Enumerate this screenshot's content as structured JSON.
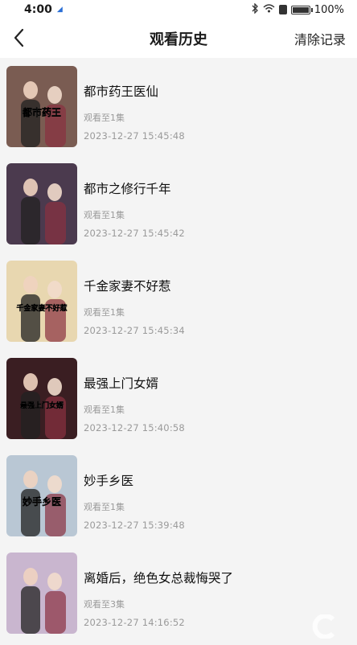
{
  "status_bar": {
    "time": "4:00",
    "battery": "100%"
  },
  "nav": {
    "title": "观看历史",
    "clear_label": "清除记录"
  },
  "items": [
    {
      "title": "都市药王医仙",
      "progress": "观看至1集",
      "time": "2023-12-27 15:45:48",
      "poster_text": "都市药王",
      "poster_color": "#7a5c52"
    },
    {
      "title": "都市之修行千年",
      "progress": "观看至1集",
      "time": "2023-12-27 15:45:42",
      "poster_text": "",
      "poster_color": "#4b3a4e"
    },
    {
      "title": "千金家妻不好惹",
      "progress": "观看至1集",
      "time": "2023-12-27 15:45:34",
      "poster_text": "千金家妻不好惹",
      "poster_color": "#e8d7b0"
    },
    {
      "title": "最强上门女婿",
      "progress": "观看至1集",
      "time": "2023-12-27 15:40:58",
      "poster_text": "最强上门女婿",
      "poster_color": "#3a1e22"
    },
    {
      "title": "妙手乡医",
      "progress": "观看至1集",
      "time": "2023-12-27 15:39:48",
      "poster_text": "妙手乡医",
      "poster_color": "#b9c7d4"
    },
    {
      "title": "离婚后，绝色女总裁悔哭了",
      "progress": "观看至3集",
      "time": "2023-12-27 14:16:52",
      "poster_text": "",
      "poster_color": "#c9b6cf"
    }
  ]
}
